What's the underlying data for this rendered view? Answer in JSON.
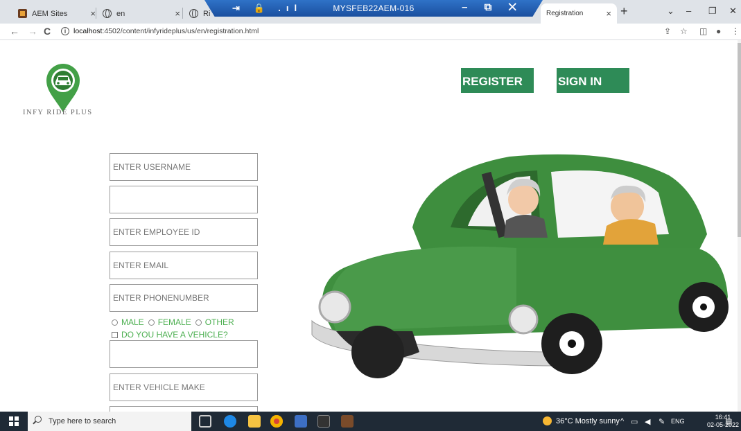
{
  "browser": {
    "tabs": [
      {
        "title": "AEM Sites",
        "close": "×"
      },
      {
        "title": "en",
        "close": "×"
      },
      {
        "title": "Ri",
        "close": ""
      },
      {
        "title": "Registration",
        "close": "×"
      }
    ],
    "new_tab": "+",
    "window_controls": {
      "dropdown": "⌄",
      "minimize": "–",
      "restore": "❐",
      "close": "✕"
    },
    "remote_title": "MYSFEB22AEM-016",
    "remote_icons": "⇥ 🔒 .ıl",
    "remote_controls": "– ⧉ ✕",
    "nav": {
      "back": "←",
      "forward": "→",
      "reload": "C"
    },
    "url_host": "localhost",
    "url_rest": ":4502/content/infyrideplus/us/en/registration.html",
    "toolbar": {
      "share": "⇪",
      "star": "☆",
      "sidebar": "◫",
      "profile": "●",
      "menu": "⋮"
    }
  },
  "page": {
    "brand": "INFY RIDE PLUS",
    "register_label": "REGISTER",
    "signin_label": "SIGN IN",
    "fields": {
      "username": "ENTER USERNAME",
      "password": "",
      "employee_id": "ENTER EMPLOYEE ID",
      "email": "ENTER EMAIL",
      "phone": "ENTER PHONENUMBER",
      "vehicle_field": "",
      "vehicle_make": "ENTER VEHICLE MAKE"
    },
    "gender_options": [
      "MALE",
      "FEMALE",
      "OTHER"
    ],
    "vehicle_question": "DO YOU HAVE A VEHICLE?",
    "accent_color": "#2e8b57"
  },
  "taskbar": {
    "search_placeholder": "Type here to search",
    "weather": "36°C  Mostly sunny",
    "language": "ENG",
    "time": "16:41",
    "date": "02-05-2022"
  }
}
